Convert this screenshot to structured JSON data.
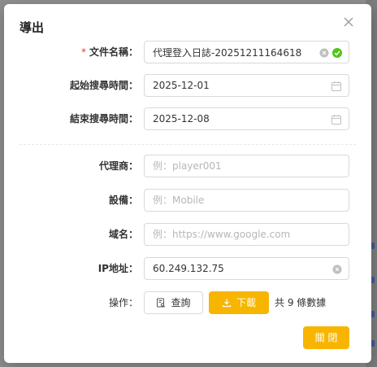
{
  "dialog": {
    "title": "導出",
    "close_icon": "close-icon"
  },
  "form": {
    "file_name": {
      "label": "文件名稱",
      "required_mark": "*",
      "value": "代理登入日誌-20251211164618",
      "icons": [
        "clear-icon",
        "check-circle-icon"
      ]
    },
    "start_time": {
      "label": "起始搜尋時間",
      "value": "2025-12-01",
      "icon": "calendar-icon"
    },
    "end_time": {
      "label": "結束搜尋時間",
      "value": "2025-12-08",
      "icon": "calendar-icon"
    },
    "agent": {
      "label": "代理商",
      "placeholder": "例：player001"
    },
    "device": {
      "label": "設備",
      "placeholder": "例：Mobile"
    },
    "domain": {
      "label": "域名",
      "placeholder": "例：https://www.google.com"
    },
    "ip": {
      "label": "IP地址",
      "value": "60.249.132.75",
      "icon": "clear-icon"
    },
    "actions": {
      "label": "操作",
      "query_label": "查詢",
      "download_label": "下載",
      "count_text": "共 9 條數據"
    }
  },
  "footer": {
    "close_label": "關 閉"
  },
  "colors": {
    "accent": "#f7b500",
    "success": "#52c41a",
    "required": "#e4393c"
  }
}
